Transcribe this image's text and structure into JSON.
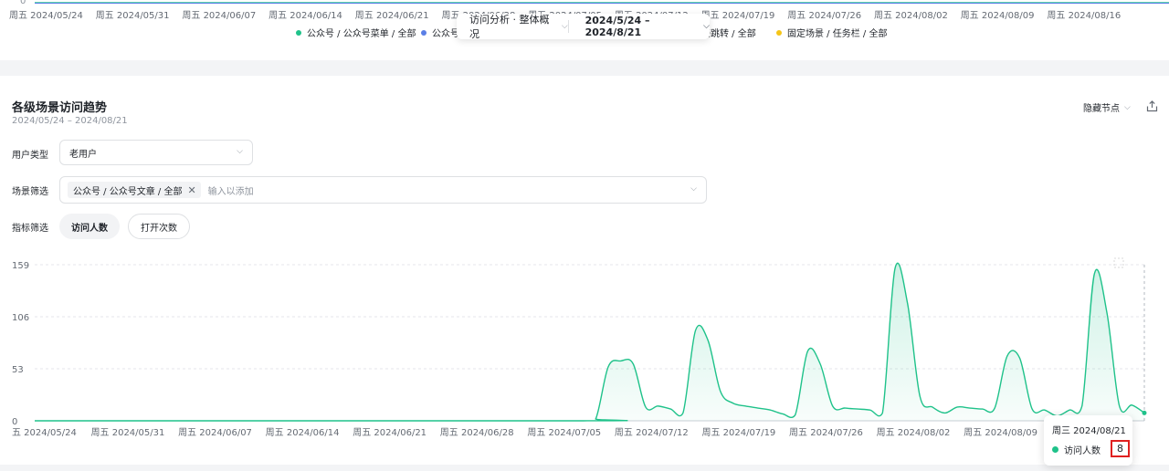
{
  "top_chart": {
    "zero_label": "0",
    "dates": [
      "周五 2024/05/24",
      "周五 2024/05/31",
      "周五 2024/06/07",
      "周五 2024/06/14",
      "周五 2024/06/21",
      "周五 2024/06/28",
      "周五 2024/07/05",
      "周五 2024/07/12",
      "周五 2024/07/19",
      "周五 2024/07/26",
      "周五 2024/08/02",
      "周五 2024/08/09",
      "周五 2024/08/16"
    ],
    "legend": [
      {
        "label": "公众号 / 公众号菜单 / 全部",
        "color": "#1fc28a"
      },
      {
        "label": "公众号",
        "color": "#5b7fe6"
      },
      {
        "label": "接跳转 / 全部",
        "color": "#1f2329"
      },
      {
        "label": "固定场景 / 任务栏 / 全部",
        "color": "#f5c518"
      }
    ]
  },
  "toolbar": {
    "analysis_label": "访问分析 · 整体概况",
    "date_range": "2024/5/24 – 2024/8/21"
  },
  "card": {
    "title": "各级场景访问趋势",
    "subtitle": "2024/05/24 – 2024/08/21",
    "hide_nodes": "隐藏节点",
    "filters": {
      "user_type_label": "用户类型",
      "user_type_value": "老用户",
      "scene_label": "场景筛选",
      "scene_tag": "公众号 / 公众号文章 / 全部",
      "scene_placeholder": "输入以添加",
      "metric_label": "指标筛选",
      "metric_active": "访问人数",
      "metric_inactive": "打开次数"
    }
  },
  "chart_data": {
    "type": "area",
    "series": [
      {
        "name": "访问人数",
        "color": "#1fc28a",
        "points": [
          [
            "2024/05/24",
            0
          ],
          [
            "2024/07/07",
            0
          ],
          [
            "2024/07/08",
            2
          ],
          [
            "2024/07/09",
            55
          ],
          [
            "2024/07/10",
            61
          ],
          [
            "2024/07/11",
            58
          ],
          [
            "2024/07/12",
            14
          ],
          [
            "2024/07/13",
            15
          ],
          [
            "2024/07/14",
            12
          ],
          [
            "2024/07/15",
            8
          ],
          [
            "2024/07/16",
            92
          ],
          [
            "2024/07/17",
            82
          ],
          [
            "2024/07/18",
            30
          ],
          [
            "2024/07/19",
            18
          ],
          [
            "2024/07/20",
            15
          ],
          [
            "2024/07/21",
            13
          ],
          [
            "2024/07/22",
            11
          ],
          [
            "2024/07/23",
            7
          ],
          [
            "2024/07/24",
            6
          ],
          [
            "2024/07/25",
            71
          ],
          [
            "2024/07/26",
            58
          ],
          [
            "2024/07/27",
            15
          ],
          [
            "2024/07/28",
            13
          ],
          [
            "2024/07/29",
            12
          ],
          [
            "2024/07/30",
            11
          ],
          [
            "2024/07/31",
            8
          ],
          [
            "2024/08/01",
            155
          ],
          [
            "2024/08/02",
            120
          ],
          [
            "2024/08/03",
            25
          ],
          [
            "2024/08/04",
            14
          ],
          [
            "2024/08/05",
            8
          ],
          [
            "2024/08/06",
            14
          ],
          [
            "2024/08/07",
            13
          ],
          [
            "2024/08/08",
            12
          ],
          [
            "2024/08/09",
            13
          ],
          [
            "2024/08/10",
            66
          ],
          [
            "2024/08/11",
            64
          ],
          [
            "2024/08/12",
            12
          ],
          [
            "2024/08/13",
            11
          ],
          [
            "2024/08/14",
            5
          ],
          [
            "2024/08/15",
            11
          ],
          [
            "2024/08/16",
            15
          ],
          [
            "2024/08/17",
            150
          ],
          [
            "2024/08/18",
            110
          ],
          [
            "2024/08/19",
            15
          ],
          [
            "2024/08/20",
            16
          ],
          [
            "2024/08/21",
            8
          ]
        ]
      }
    ],
    "y_ticks": [
      0,
      53,
      106,
      159
    ],
    "ylim": [
      0,
      159
    ],
    "x_tick_labels": [
      "五 2024/05/24",
      "周五 2024/05/31",
      "周五 2024/06/07",
      "周五 2024/06/14",
      "周五 2024/06/21",
      "周五 2024/06/28",
      "周五 2024/07/05",
      "周五 2024/07/12",
      "周五 2024/07/19",
      "周五 2024/07/26",
      "周五 2024/08/02",
      "周五 2024/08/09"
    ],
    "x_tick_dates": [
      "2024/05/24",
      "2024/05/31",
      "2024/06/07",
      "2024/06/14",
      "2024/06/21",
      "2024/06/28",
      "2024/07/05",
      "2024/07/12",
      "2024/07/19",
      "2024/07/26",
      "2024/08/02",
      "2024/08/09"
    ],
    "grid": true,
    "tooltip": {
      "date": "周三 2024/08/21",
      "series_name": "访问人数",
      "value": "8"
    }
  }
}
